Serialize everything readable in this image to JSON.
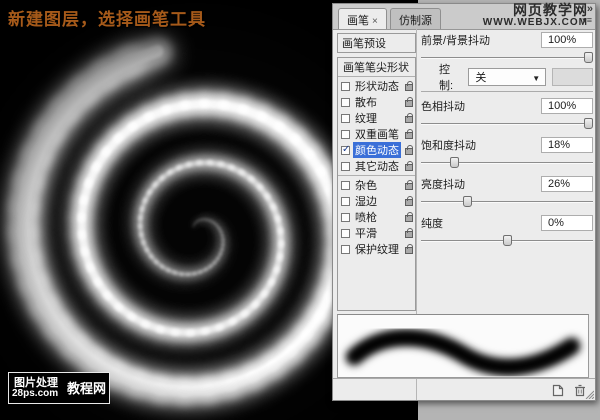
{
  "page": {
    "background": "#b4b4b4",
    "image_bg": "#000000"
  },
  "artwork": {
    "caption": "新建图层，选择画笔工具",
    "caption_color": "#a65a1a",
    "logo": {
      "line1": "图片处理",
      "line2": "28ps.com",
      "suffix": "教程网"
    }
  },
  "site_watermark": {
    "title": "网页教学网",
    "url": "www.webjx.com"
  },
  "panel": {
    "selection_color": "#3a6fd8",
    "tabs": [
      {
        "label": "画笔",
        "close": "×",
        "active": true
      },
      {
        "label": "仿制源",
        "active": false
      }
    ],
    "collapse_icon": "»",
    "list": [
      {
        "label": "画笔预设"
      },
      {
        "label": "画笔笔尖形状"
      },
      {
        "label": "形状动态",
        "checked": false
      },
      {
        "label": "散布",
        "checked": false
      },
      {
        "label": "纹理",
        "checked": false
      },
      {
        "label": "双重画笔",
        "checked": false
      },
      {
        "label": "颜色动态",
        "checked": true,
        "selected": true
      },
      {
        "label": "其它动态",
        "checked": false
      },
      {
        "label": "杂色",
        "checked": false
      },
      {
        "label": "湿边",
        "checked": false
      },
      {
        "label": "喷枪",
        "checked": false
      },
      {
        "label": "平滑",
        "checked": false
      },
      {
        "label": "保护纹理",
        "checked": false
      }
    ],
    "controls": {
      "fg_bg_jitter": {
        "label": "前景/背景抖动",
        "value": "100%",
        "percent": 100
      },
      "control_row": {
        "label": "控制:",
        "selected": "关"
      },
      "hue": {
        "label": "色相抖动",
        "value": "100%",
        "percent": 100
      },
      "saturation": {
        "label": "饱和度抖动",
        "value": "18%",
        "percent": 18
      },
      "brightness": {
        "label": "亮度抖动",
        "value": "26%",
        "percent": 26
      },
      "purity": {
        "label": "纯度",
        "value": "0%",
        "percent": 50
      }
    }
  }
}
